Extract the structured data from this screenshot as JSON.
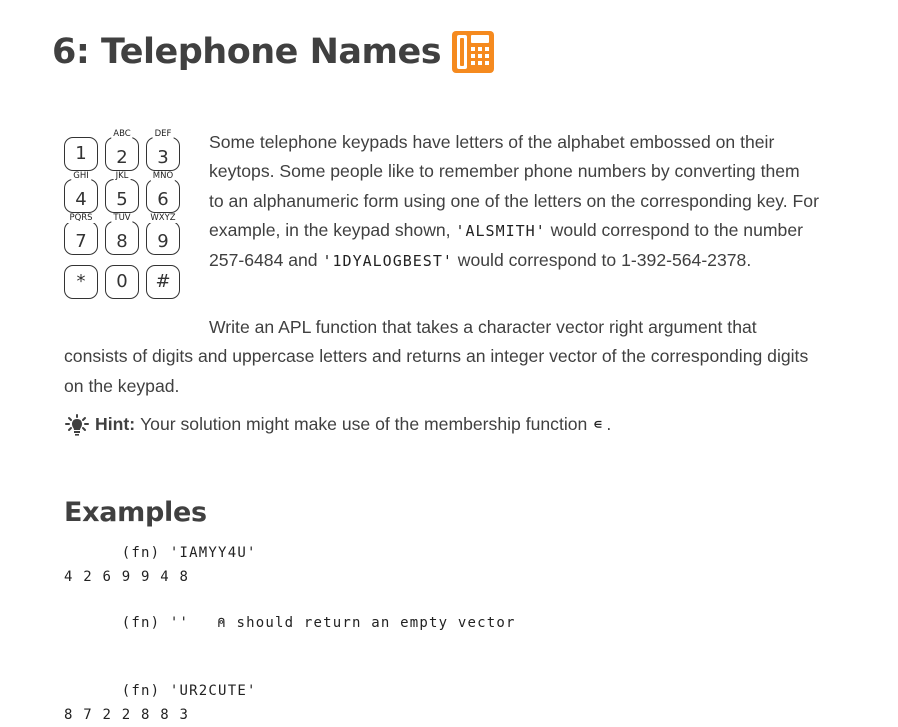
{
  "title": {
    "text": "6: Telephone Names",
    "icon": "phone-keypad-icon",
    "icon_color": "#f58a1f"
  },
  "keypad": {
    "keys": [
      {
        "digit": "1",
        "letters": ""
      },
      {
        "digit": "2",
        "letters": "ABC"
      },
      {
        "digit": "3",
        "letters": "DEF"
      },
      {
        "digit": "4",
        "letters": "GHI"
      },
      {
        "digit": "5",
        "letters": "JKL"
      },
      {
        "digit": "6",
        "letters": "MNO"
      },
      {
        "digit": "7",
        "letters": "PQRS"
      },
      {
        "digit": "8",
        "letters": "TUV"
      },
      {
        "digit": "9",
        "letters": "WXYZ"
      },
      {
        "digit": "*",
        "letters": ""
      },
      {
        "digit": "0",
        "letters": ""
      },
      {
        "digit": "#",
        "letters": ""
      }
    ]
  },
  "intro": {
    "text_before": "Some telephone keypads have letters of the alphabet embossed on their keytops. Some people like to remember phone numbers by converting them to an alphanumeric form using one of the letters on the corresponding key. For example, in the keypad shown, ",
    "code1": "'ALSMITH'",
    "text_middle": " would correspond to the number 257-6484 and ",
    "code2": "'1DYALOGBEST'",
    "text_after": " would correspond to 1-392-564-2378."
  },
  "task": {
    "text": "Write an APL function that takes a character vector right argument that consists of digits and uppercase letters and returns an integer vector of the corresponding digits on the keypad."
  },
  "hint": {
    "icon": "lightbulb-icon",
    "label": "Hint:",
    "text": "Your solution might make use of the membership function",
    "symbol": "∊",
    "end": "."
  },
  "examples": {
    "heading": "Examples",
    "lines": [
      {
        "input": "      (fn) 'IAMYY4U'",
        "comment": ""
      },
      {
        "output": "4 2 6 9 9 4 8"
      },
      {
        "spacer": true
      },
      {
        "input": "      (fn) ''",
        "comment": "⍝ should return an empty vector"
      },
      {
        "spacer": true
      },
      {
        "spacer": true
      },
      {
        "input": "      (fn) 'UR2CUTE'",
        "comment": ""
      },
      {
        "output": "8 7 2 2 8 8 3"
      }
    ]
  }
}
